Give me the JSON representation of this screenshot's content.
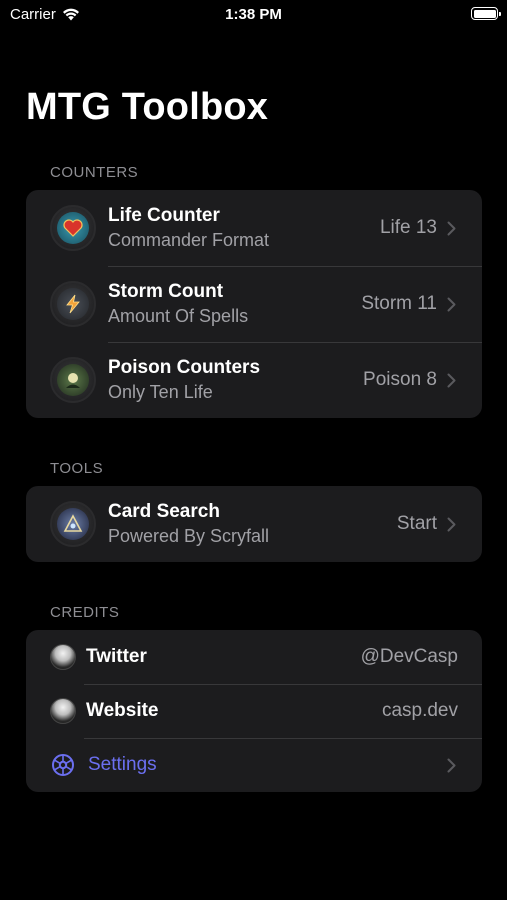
{
  "status_bar": {
    "carrier": "Carrier",
    "time": "1:38 PM"
  },
  "title": "MTG Toolbox",
  "sections": {
    "counters": {
      "header": "COUNTERS",
      "items": [
        {
          "title": "Life Counter",
          "subtitle": "Commander Format",
          "value": "Life 13",
          "icon": "heart-shield-icon"
        },
        {
          "title": "Storm Count",
          "subtitle": "Amount Of Spells",
          "value": "Storm 11",
          "icon": "lightning-icon"
        },
        {
          "title": "Poison Counters",
          "subtitle": "Only Ten Life",
          "value": "Poison 8",
          "icon": "poison-moon-icon"
        }
      ]
    },
    "tools": {
      "header": "TOOLS",
      "items": [
        {
          "title": "Card Search",
          "subtitle": "Powered By Scryfall",
          "value": "Start",
          "icon": "search-sigil-icon"
        }
      ]
    },
    "credits": {
      "header": "CREDITS",
      "items": [
        {
          "title": "Twitter",
          "value": "@DevCasp"
        },
        {
          "title": "Website",
          "value": "casp.dev"
        }
      ],
      "settings_label": "Settings"
    }
  },
  "colors": {
    "accent": "#6b6ff0",
    "cell_bg": "#1c1c1e",
    "secondary_text": "#a1a1a6"
  }
}
